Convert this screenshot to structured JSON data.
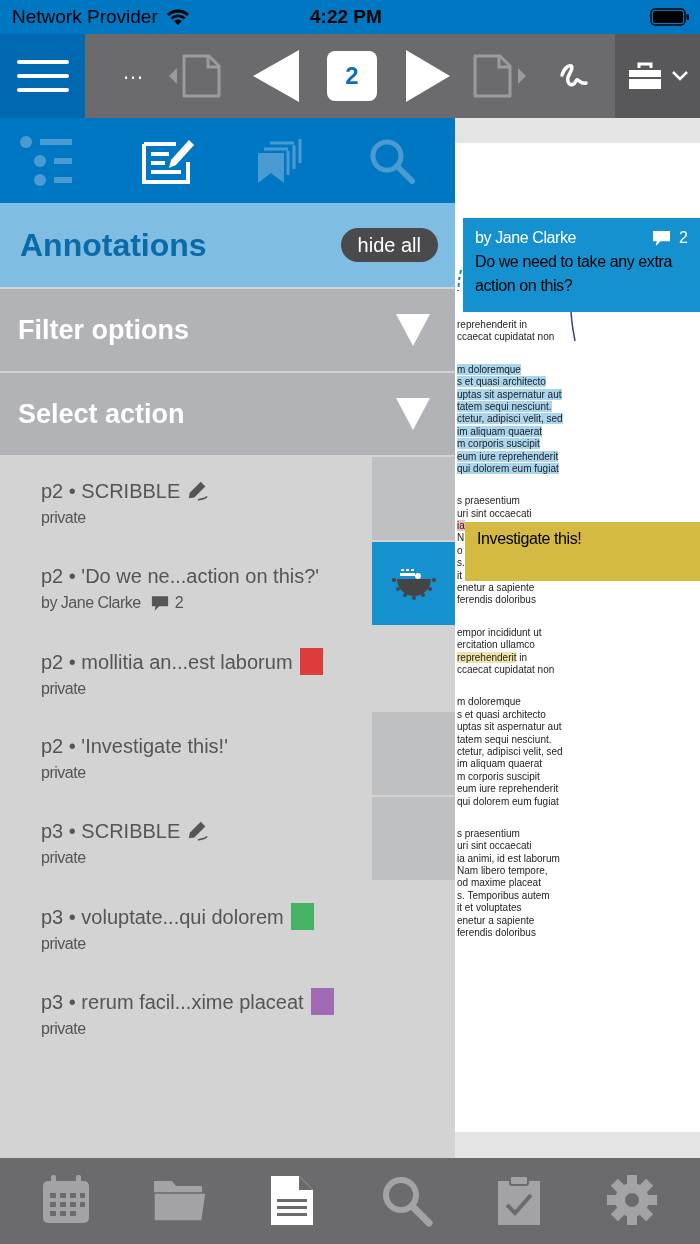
{
  "status_bar": {
    "carrier": "Network Provider",
    "time": "4:22 PM"
  },
  "toolbar": {
    "more": "…",
    "page": "2"
  },
  "panel_tabs": [
    {
      "kind": "outline",
      "selected": false
    },
    {
      "kind": "annotations",
      "selected": true
    },
    {
      "kind": "bookmarks",
      "selected": false
    },
    {
      "kind": "search",
      "selected": false
    }
  ],
  "annotations_header": {
    "title": "Annotations",
    "button": "hide all"
  },
  "sections": [
    {
      "label": "Filter options",
      "expanded": false
    },
    {
      "label": "Select action",
      "expanded": false
    }
  ],
  "annotations": [
    {
      "kind": "scribble",
      "title": "p2 • SCRIBBLE",
      "subtitle": "private",
      "selected": false
    },
    {
      "kind": "note",
      "title": "p2 • 'Do we ne...action on this?'",
      "subtitle": "by Jane Clarke",
      "comments": "2",
      "selected": true
    },
    {
      "kind": "highlight",
      "title": "p2 • mollitia an...est laborum",
      "subtitle": "private",
      "color": "#dc3c3c",
      "selected": false
    },
    {
      "kind": "text",
      "title": "p2 • 'Investigate this!'",
      "subtitle": "private",
      "selected": false
    },
    {
      "kind": "scribble",
      "title": "p3 • SCRIBBLE",
      "subtitle": "private",
      "selected": false
    },
    {
      "kind": "highlight",
      "title": "p3 • voluptate...qui dolorem",
      "subtitle": "private",
      "color": "#46b464",
      "selected": false
    },
    {
      "kind": "highlight",
      "title": "p3 • rerum facil...xime placeat",
      "subtitle": "private",
      "color": "#a06ab4",
      "selected": false
    }
  ],
  "document": {
    "paragraphs": [
      [
        {
          "text": "reprehenderit in"
        },
        {
          "text": "ccaecat cupidatat non"
        }
      ],
      [
        {
          "text": "m doloremque",
          "color": "#a9d6ee"
        },
        {
          "text": "s et quasi architecto",
          "color": "#a9d6ee"
        },
        {
          "text": "uptas sit aspernatur aut",
          "color": "#a9d6ee"
        },
        {
          "text": "tatem sequi nesciunt.",
          "color": "#a9d6ee"
        },
        {
          "text": "ctetur, adipisci velit, sed",
          "color": "#a9d6ee"
        },
        {
          "text": "im aliquam quaerat",
          "color": "#a9d6ee"
        },
        {
          "text": "m corporis suscipit",
          "color": "#a9d6ee"
        },
        {
          "text": "eum iure reprehenderit",
          "color": "#a9d6ee"
        },
        {
          "text": "qui dolorem eum fugiat",
          "color": "#a9d6ee"
        }
      ],
      [
        {
          "text": "s praesentium"
        },
        {
          "text": "uri sint occaecati"
        },
        {
          "text": "ia",
          "color": "#f3b9b9"
        },
        {
          "text": "N"
        },
        {
          "text": "o"
        },
        {
          "text": "s."
        },
        {
          "text": "it"
        },
        {
          "text": "enetur a sapiente"
        },
        {
          "text": "ferendis doloribus"
        }
      ],
      [
        {
          "text": "empor incididunt ut"
        },
        {
          "text": "ercitation ullamco"
        },
        {
          "parts": [
            {
              "text": "reprehenderit",
              "color": "#efe2aa"
            },
            {
              "text": " in"
            }
          ]
        },
        {
          "text": "ccaecat cupidatat non"
        }
      ],
      [
        {
          "text": "m doloremque"
        },
        {
          "text": "s et quasi architecto"
        },
        {
          "text": "uptas sit aspernatur aut"
        },
        {
          "text": "tatem sequi nesciunt."
        },
        {
          "text": "ctetur, adipisci velit, sed"
        },
        {
          "text": "im aliquam quaerat"
        },
        {
          "text": "m corporis suscipit"
        },
        {
          "text": "eum iure reprehenderit"
        },
        {
          "text": "qui dolorem eum fugiat"
        }
      ],
      [
        {
          "text": "s praesentium"
        },
        {
          "text": "uri sint occaecati"
        },
        {
          "text": "ia animi, id est laborum"
        },
        {
          "text": "Nam libero tempore,"
        },
        {
          "text": "od maxime placeat"
        },
        {
          "text": "s. Temporibus autem"
        },
        {
          "text": "it et voluptates"
        },
        {
          "text": "enetur a sapiente"
        },
        {
          "text": "ferendis doloribus"
        }
      ]
    ]
  },
  "notes": [
    {
      "kind": "comment",
      "author": "by Jane Clarke",
      "comments": "2",
      "text": "Do we need to take any extra action on this?"
    },
    {
      "kind": "text",
      "text": "Investigate this!"
    }
  ],
  "bottom_nav": [
    {
      "kind": "calendar",
      "selected": false
    },
    {
      "kind": "folder",
      "selected": false
    },
    {
      "kind": "document",
      "selected": true
    },
    {
      "kind": "search",
      "selected": false
    },
    {
      "kind": "clipboard",
      "selected": false
    },
    {
      "kind": "settings",
      "selected": false
    }
  ]
}
